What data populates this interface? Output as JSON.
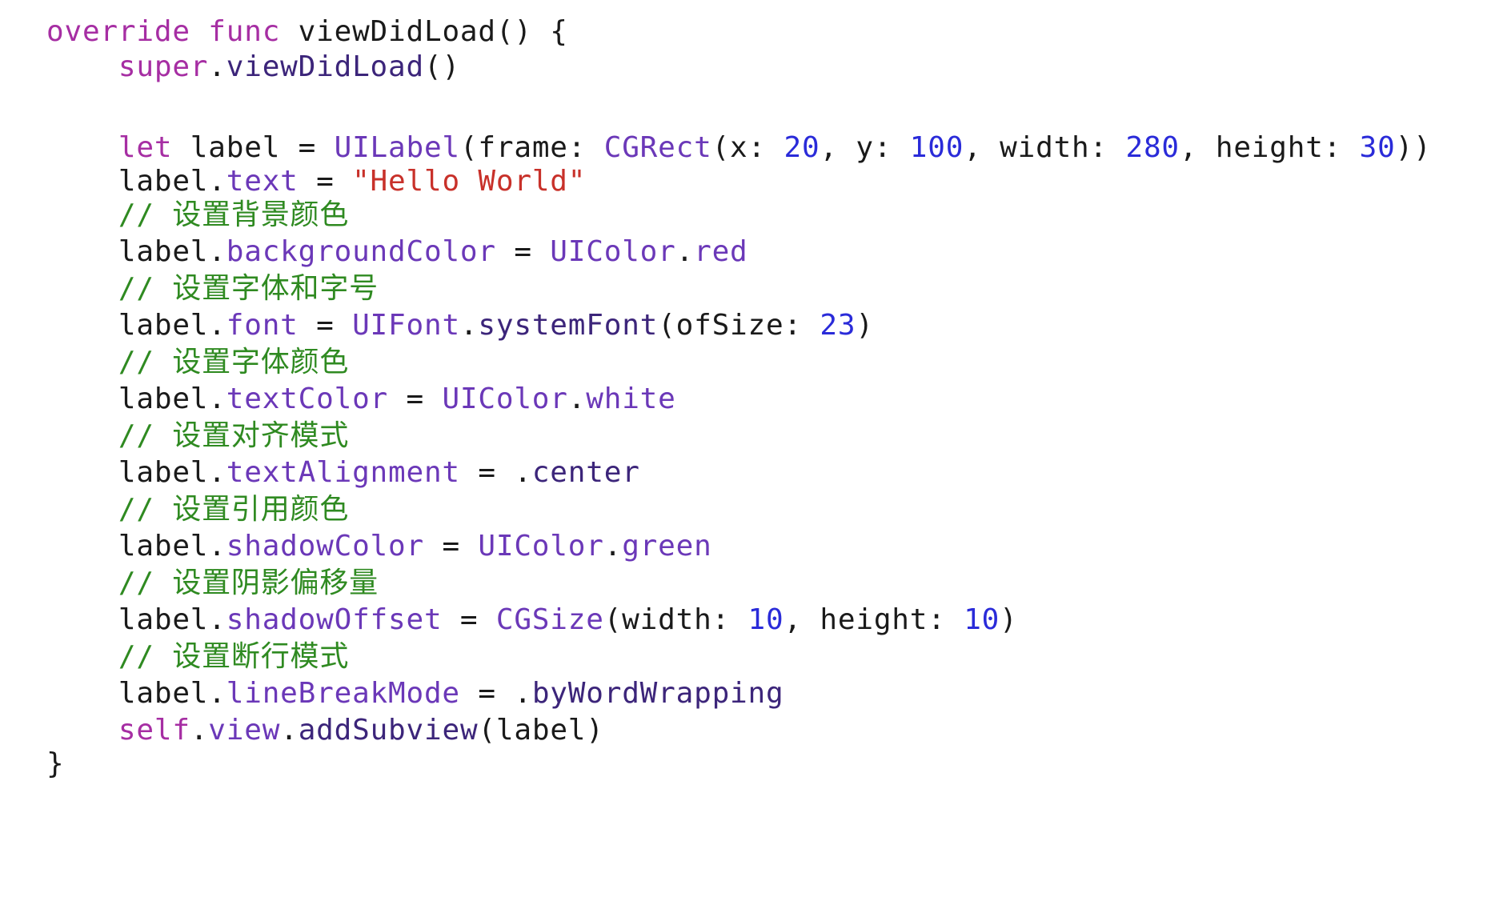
{
  "colors": {
    "background": "#ffffff",
    "keyword": "#a62ea3",
    "type": "#6b38b8",
    "property": "#6b38b8",
    "function": "#3c257a",
    "number": "#2a2bd9",
    "string": "#c8312a",
    "comment": "#2f8a21",
    "plain": "#1a1a1a"
  },
  "code": {
    "lines": [
      {
        "tokens": [
          {
            "t": "override",
            "k": "kw"
          },
          {
            "t": " ",
            "k": "plain"
          },
          {
            "t": "func",
            "k": "kw"
          },
          {
            "t": " viewDidLoad() {",
            "k": "plain"
          }
        ]
      },
      {
        "tokens": [
          {
            "t": "    ",
            "k": "plain"
          },
          {
            "t": "super",
            "k": "kw"
          },
          {
            "t": ".",
            "k": "plain"
          },
          {
            "t": "viewDidLoad",
            "k": "fn"
          },
          {
            "t": "()",
            "k": "plain"
          }
        ]
      },
      {
        "tokens": [
          {
            "t": "",
            "k": "plain"
          }
        ]
      },
      {
        "tokens": [
          {
            "t": "    ",
            "k": "plain"
          },
          {
            "t": "let",
            "k": "kw"
          },
          {
            "t": " label = ",
            "k": "plain"
          },
          {
            "t": "UILabel",
            "k": "typ"
          },
          {
            "t": "(frame: ",
            "k": "plain"
          },
          {
            "t": "CGRect",
            "k": "typ"
          },
          {
            "t": "(x: ",
            "k": "plain"
          },
          {
            "t": "20",
            "k": "num"
          },
          {
            "t": ", y: ",
            "k": "plain"
          },
          {
            "t": "100",
            "k": "num"
          },
          {
            "t": ", width: ",
            "k": "plain"
          },
          {
            "t": "280",
            "k": "num"
          },
          {
            "t": ", height: ",
            "k": "plain"
          },
          {
            "t": "30",
            "k": "num"
          },
          {
            "t": "))",
            "k": "plain"
          }
        ]
      },
      {
        "tokens": [
          {
            "t": "    label.",
            "k": "plain"
          },
          {
            "t": "text",
            "k": "prop"
          },
          {
            "t": " = ",
            "k": "plain"
          },
          {
            "t": "\"Hello World\"",
            "k": "str"
          }
        ]
      },
      {
        "tokens": [
          {
            "t": "    ",
            "k": "plain"
          },
          {
            "t": "// 设置背景颜色",
            "k": "cmt"
          }
        ]
      },
      {
        "tokens": [
          {
            "t": "    label.",
            "k": "plain"
          },
          {
            "t": "backgroundColor",
            "k": "prop"
          },
          {
            "t": " = ",
            "k": "plain"
          },
          {
            "t": "UIColor",
            "k": "typ"
          },
          {
            "t": ".",
            "k": "plain"
          },
          {
            "t": "red",
            "k": "prop"
          }
        ]
      },
      {
        "tokens": [
          {
            "t": "    ",
            "k": "plain"
          },
          {
            "t": "// 设置字体和字号",
            "k": "cmt"
          }
        ]
      },
      {
        "tokens": [
          {
            "t": "    label.",
            "k": "plain"
          },
          {
            "t": "font",
            "k": "prop"
          },
          {
            "t": " = ",
            "k": "plain"
          },
          {
            "t": "UIFont",
            "k": "typ"
          },
          {
            "t": ".",
            "k": "plain"
          },
          {
            "t": "systemFont",
            "k": "fn"
          },
          {
            "t": "(ofSize: ",
            "k": "plain"
          },
          {
            "t": "23",
            "k": "num"
          },
          {
            "t": ")",
            "k": "plain"
          }
        ]
      },
      {
        "tokens": [
          {
            "t": "    ",
            "k": "plain"
          },
          {
            "t": "// 设置字体颜色",
            "k": "cmt"
          }
        ]
      },
      {
        "tokens": [
          {
            "t": "    label.",
            "k": "plain"
          },
          {
            "t": "textColor",
            "k": "prop"
          },
          {
            "t": " = ",
            "k": "plain"
          },
          {
            "t": "UIColor",
            "k": "typ"
          },
          {
            "t": ".",
            "k": "plain"
          },
          {
            "t": "white",
            "k": "prop"
          }
        ]
      },
      {
        "tokens": [
          {
            "t": "    ",
            "k": "plain"
          },
          {
            "t": "// 设置对齐模式",
            "k": "cmt"
          }
        ]
      },
      {
        "tokens": [
          {
            "t": "    label.",
            "k": "plain"
          },
          {
            "t": "textAlignment",
            "k": "prop"
          },
          {
            "t": " = .",
            "k": "plain"
          },
          {
            "t": "center",
            "k": "fn"
          }
        ]
      },
      {
        "tokens": [
          {
            "t": "    ",
            "k": "plain"
          },
          {
            "t": "// 设置引用颜色",
            "k": "cmt"
          }
        ]
      },
      {
        "tokens": [
          {
            "t": "    label.",
            "k": "plain"
          },
          {
            "t": "shadowColor",
            "k": "prop"
          },
          {
            "t": " = ",
            "k": "plain"
          },
          {
            "t": "UIColor",
            "k": "typ"
          },
          {
            "t": ".",
            "k": "plain"
          },
          {
            "t": "green",
            "k": "prop"
          }
        ]
      },
      {
        "tokens": [
          {
            "t": "    ",
            "k": "plain"
          },
          {
            "t": "// 设置阴影偏移量",
            "k": "cmt"
          }
        ]
      },
      {
        "tokens": [
          {
            "t": "    label.",
            "k": "plain"
          },
          {
            "t": "shadowOffset",
            "k": "prop"
          },
          {
            "t": " = ",
            "k": "plain"
          },
          {
            "t": "CGSize",
            "k": "typ"
          },
          {
            "t": "(width: ",
            "k": "plain"
          },
          {
            "t": "10",
            "k": "num"
          },
          {
            "t": ", height: ",
            "k": "plain"
          },
          {
            "t": "10",
            "k": "num"
          },
          {
            "t": ")",
            "k": "plain"
          }
        ]
      },
      {
        "tokens": [
          {
            "t": "    ",
            "k": "plain"
          },
          {
            "t": "// 设置断行模式",
            "k": "cmt"
          }
        ]
      },
      {
        "tokens": [
          {
            "t": "    label.",
            "k": "plain"
          },
          {
            "t": "lineBreakMode",
            "k": "prop"
          },
          {
            "t": " = .",
            "k": "plain"
          },
          {
            "t": "byWordWrapping",
            "k": "fn"
          }
        ]
      },
      {
        "tokens": [
          {
            "t": "    ",
            "k": "plain"
          },
          {
            "t": "self",
            "k": "kw"
          },
          {
            "t": ".",
            "k": "plain"
          },
          {
            "t": "view",
            "k": "prop"
          },
          {
            "t": ".",
            "k": "plain"
          },
          {
            "t": "addSubview",
            "k": "fn"
          },
          {
            "t": "(label)",
            "k": "plain"
          }
        ]
      },
      {
        "tokens": [
          {
            "t": "}",
            "k": "plain"
          }
        ]
      }
    ]
  }
}
